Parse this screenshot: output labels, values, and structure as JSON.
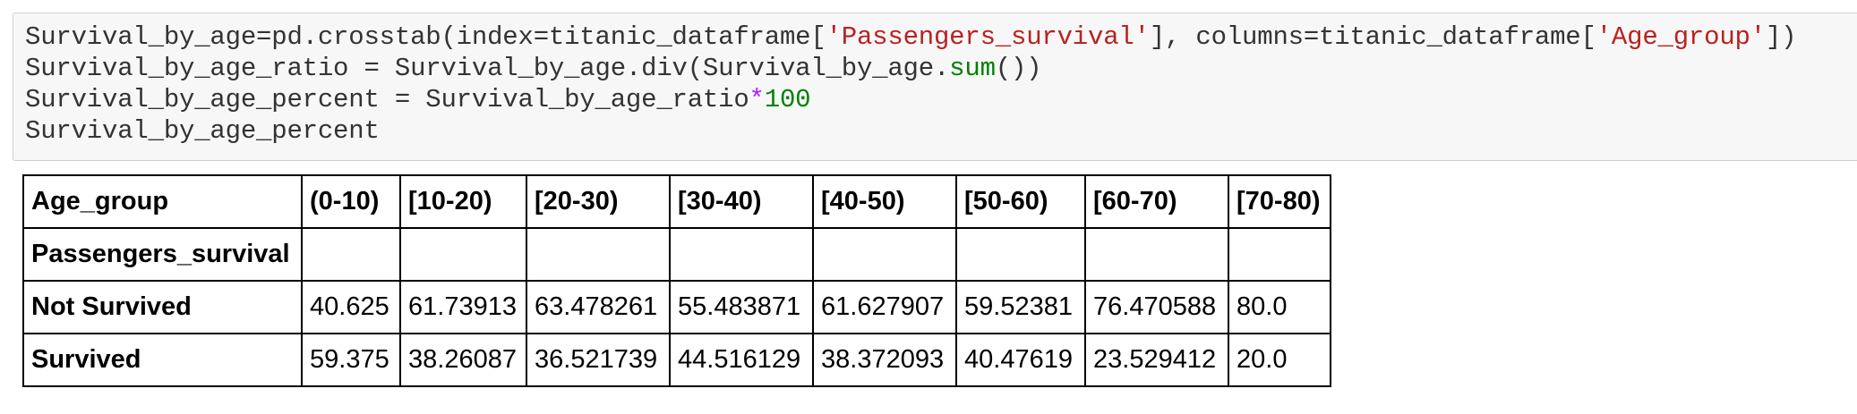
{
  "code_cell": {
    "line1": {
      "pre": "Survival_by_age=pd.crosstab(index=titanic_dataframe[",
      "str1": "'Passengers_survival'",
      "mid": "], columns=titanic_dataframe[",
      "str2": "'Age_group'",
      "post": "])"
    },
    "line2": {
      "pre": "Survival_by_age_ratio = Survival_by_age.div(Survival_by_age.",
      "fn": "sum",
      "post": "())"
    },
    "line3": {
      "pre": "Survival_by_age_percent = Survival_by_age_ratio",
      "op": "*",
      "num": "100"
    },
    "line4": "Survival_by_age_percent"
  },
  "table": {
    "columns_name": "Age_group",
    "columns": [
      "(0-10)",
      "[10-20)",
      "[20-30)",
      "[30-40)",
      "[40-50)",
      "[50-60)",
      "[60-70)",
      "[70-80)"
    ],
    "index_name": "Passengers_survival",
    "rows": [
      {
        "label": "Not Survived",
        "values": [
          "40.625",
          "61.73913",
          "63.478261",
          "55.483871",
          "61.627907",
          "59.52381",
          "76.470588",
          "80.0"
        ]
      },
      {
        "label": "Survived",
        "values": [
          "59.375",
          "38.26087",
          "36.521739",
          "44.516129",
          "38.372093",
          "40.47619",
          "23.529412",
          "20.0"
        ]
      }
    ]
  }
}
